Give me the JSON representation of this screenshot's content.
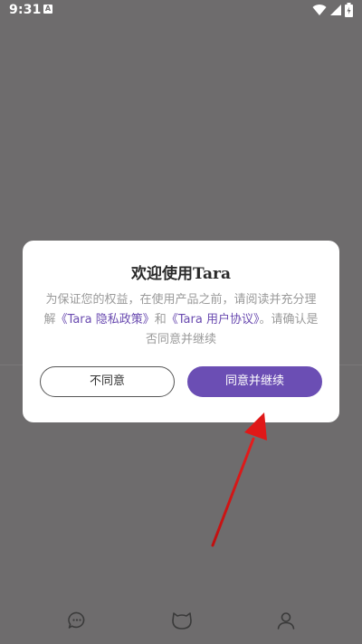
{
  "status_bar": {
    "time": "9:31",
    "notification_letter": "A"
  },
  "dialog": {
    "title": "欢迎使用Tara",
    "body_part1": "为保证您的权益，在使用产品之前，请阅读并充分理解",
    "privacy_link": "《Tara 隐私政策》",
    "connector": "和",
    "agreement_link": "《Tara 用户协议》",
    "body_part2": "。请确认是否同意并继续",
    "disagree_label": "不同意",
    "agree_label": "同意并继续"
  },
  "bottom_nav": {
    "items": [
      {
        "icon": "chat-bubble-icon"
      },
      {
        "icon": "cat-face-icon"
      },
      {
        "icon": "person-icon"
      }
    ]
  },
  "colors": {
    "overlay": "#6e6c6d",
    "accent": "#6b4eb4",
    "link": "#6a4bb0",
    "annotation": "#e01818"
  }
}
